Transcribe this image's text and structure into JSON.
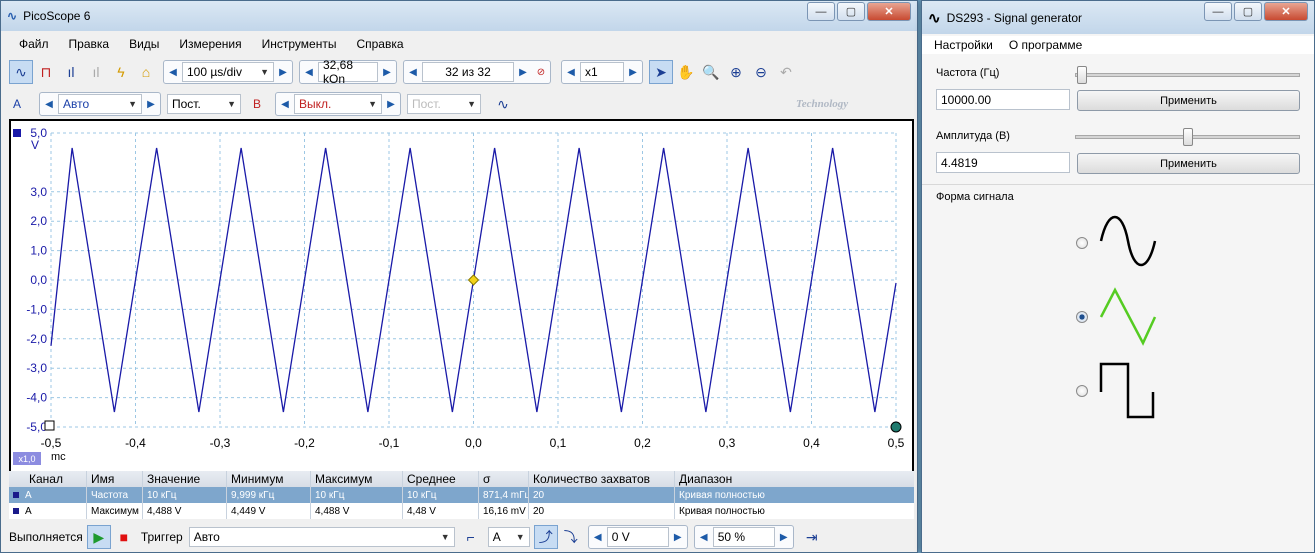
{
  "pico": {
    "title": "PicoScope 6",
    "menu": [
      "Файл",
      "Правка",
      "Виды",
      "Измерения",
      "Инструменты",
      "Справка"
    ],
    "timebase": "100 µs/div",
    "samples": "32,68 kOn",
    "captures": "32 из 32",
    "zoom": "x1",
    "chA_label": "A",
    "chA_range": "Авто",
    "chA_coupling": "Пост.",
    "chB_label": "B",
    "chB_range": "Выкл.",
    "chB_coupling": "Пост.",
    "watermark": "Technology",
    "y_unit": "V",
    "x_unit": "mc",
    "x_scale_badge": "x1,0",
    "table_headers": [
      "Канал",
      "Имя",
      "Значение",
      "Минимум",
      "Максимум",
      "Среднее",
      "σ",
      "Количество захватов",
      "Диапазон"
    ],
    "rows": [
      [
        "A",
        "Частота",
        "10 кГц",
        "9,999 кГц",
        "10 кГц",
        "10 кГц",
        "871,4 mГц",
        "20",
        "Кривая полностью"
      ],
      [
        "A",
        "Максимум",
        "4,488 V",
        "4,449 V",
        "4,488 V",
        "4,48 V",
        "16,16 mV",
        "20",
        "Кривая полностью"
      ]
    ],
    "status": "Выполняется",
    "trigger_label": "Триггер",
    "trigger_mode": "Авто",
    "trigger_channel": "A",
    "trigger_level": "0 V",
    "pretrigger": "50 %"
  },
  "chart_data": {
    "type": "line",
    "title": "",
    "xlabel": "mc",
    "ylabel": "V",
    "xlim": [
      -0.5,
      0.5
    ],
    "ylim": [
      -5.0,
      5.0
    ],
    "x_ticks": [
      "-0,5",
      "-0,4",
      "-0,3",
      "-0,2",
      "-0,1",
      "0,0",
      "0,1",
      "0,2",
      "0,3",
      "0,4",
      "0,5"
    ],
    "y_ticks": [
      "5,0",
      "3,0",
      "2,0",
      "1,0",
      "0,0",
      "-1,0",
      "-2,0",
      "-3,0",
      "-4,0",
      "-5,0"
    ],
    "grid": true,
    "series": [
      {
        "color": "#1a1aa8",
        "waveform": "triangle",
        "frequency_khz": 10,
        "amplitude_v": 4.488,
        "x": [
          -0.5,
          -0.475,
          -0.425,
          -0.375,
          -0.325,
          -0.275,
          -0.225,
          -0.175,
          -0.125,
          -0.075,
          -0.025,
          0.025,
          0.075,
          0.125,
          0.175,
          0.225,
          0.275,
          0.325,
          0.375,
          0.425,
          0.475,
          0.5
        ],
        "y": [
          -2.24,
          4.49,
          -4.49,
          4.49,
          -4.49,
          4.49,
          -4.49,
          4.49,
          -4.49,
          4.49,
          -4.49,
          4.49,
          -4.49,
          4.49,
          -4.49,
          4.49,
          -4.49,
          4.49,
          -4.49,
          4.49,
          -4.49,
          -0.1
        ]
      }
    ]
  },
  "sg": {
    "title": "DS293 - Signal generator",
    "menu": [
      "Настройки",
      "О программе"
    ],
    "freq_label": "Частота (Гц)",
    "freq_value": "10000.00",
    "apply": "Применить",
    "amp_label": "Амплитуда (В)",
    "amp_value": "4.4819",
    "shape_label": "Форма сигнала",
    "amp_slider_fraction": 0.5,
    "selected_shape": "triangle"
  }
}
